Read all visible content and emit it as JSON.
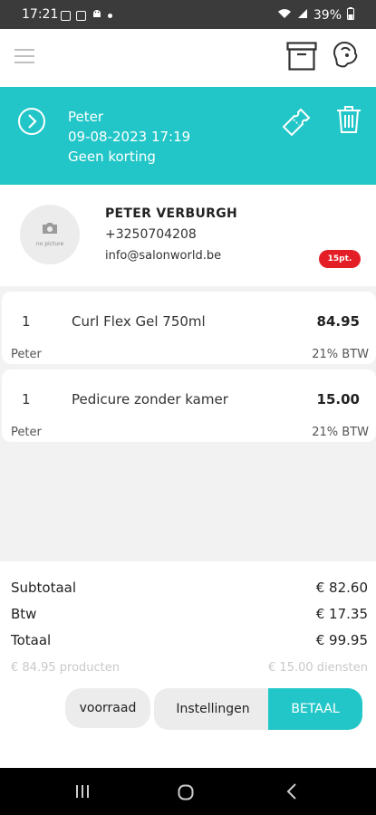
{
  "status_bar": {
    "time": "17:21",
    "battery": "39%"
  },
  "order": {
    "employee": "Peter",
    "datetime": "09-08-2023 17:19",
    "discount": "Geen korting"
  },
  "customer": {
    "avatar_text": "no picture",
    "name": "PETER VERBURGH",
    "phone": "+3250704208",
    "email": "info@salonworld.be",
    "points": "15pt."
  },
  "items": [
    {
      "qty": "1",
      "name": "Curl Flex Gel 750ml",
      "price": "84.95",
      "employee": "Peter",
      "vat": "21% BTW"
    },
    {
      "qty": "1",
      "name": "Pedicure zonder kamer",
      "price": "15.00",
      "employee": "Peter",
      "vat": "21% BTW"
    }
  ],
  "totals": {
    "subtotal_label": "Subtotaal",
    "subtotal_value": "€ 82.60",
    "vat_label": "Btw",
    "vat_value": "€ 17.35",
    "total_label": "Totaal",
    "total_value": "€ 99.95",
    "products": "€ 84.95 producten",
    "services": "€ 15.00 diensten"
  },
  "buttons": {
    "stock": "voorraad",
    "settings": "Instellingen",
    "pay": "BETAAL"
  },
  "colors": {
    "accent": "#23c6c8",
    "badge": "#e41e26"
  }
}
